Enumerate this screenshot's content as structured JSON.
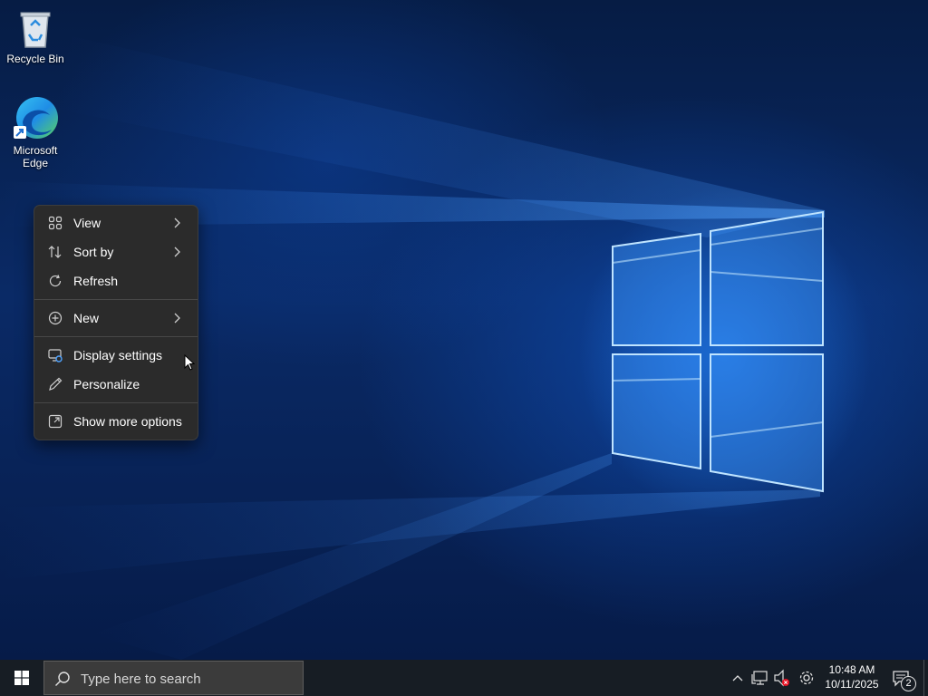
{
  "desktop": {
    "icons": [
      {
        "label": "Recycle Bin",
        "icon": "recycle-bin-icon"
      },
      {
        "label": "Microsoft Edge",
        "icon": "edge-icon"
      }
    ]
  },
  "context_menu": {
    "items": [
      {
        "label": "View",
        "icon": "view-grid-icon",
        "has_submenu": true
      },
      {
        "label": "Sort by",
        "icon": "sort-icon",
        "has_submenu": true
      },
      {
        "label": "Refresh",
        "icon": "refresh-icon",
        "has_submenu": false
      },
      {
        "label": "New",
        "icon": "plus-circle-icon",
        "has_submenu": true
      },
      {
        "label": "Display settings",
        "icon": "display-settings-icon",
        "has_submenu": false
      },
      {
        "label": "Personalize",
        "icon": "pen-icon",
        "has_submenu": false
      },
      {
        "label": "Show more options",
        "icon": "more-options-icon",
        "has_submenu": false
      }
    ]
  },
  "taskbar": {
    "search_placeholder": "Type here to search",
    "clock": {
      "time": "10:48 AM",
      "date": "10/11/2025"
    },
    "notification_count": "2"
  },
  "colors": {
    "menu_bg": "#2b2b2b",
    "taskbar_bg": "#171d24",
    "accent": "#1e90ff"
  }
}
